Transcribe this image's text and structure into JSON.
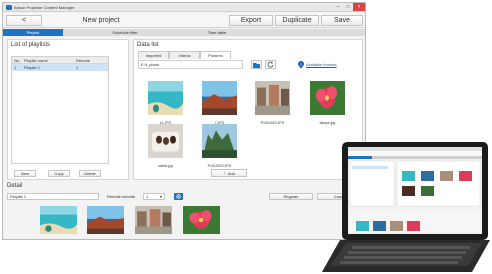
{
  "app_title": "Epson Projector Content Manager",
  "toolbar": {
    "back": "<",
    "project_name": "New project",
    "export": "Export",
    "duplicate": "Duplicate",
    "save": "Save"
  },
  "tabs": [
    "Playlist",
    "Schedule filter",
    "Time table"
  ],
  "playlists": {
    "heading": "List of playlists",
    "columns": [
      "No.",
      "Playlist name",
      "Remote"
    ],
    "rows": [
      {
        "no": "1",
        "name": "Playlist 1",
        "remote": "1"
      }
    ],
    "buttons": {
      "new": "New",
      "copy": "Copy",
      "delete": "Delete"
    }
  },
  "data_list": {
    "heading": "Data list",
    "tabs": [
      "Imported",
      "Videos",
      "Pictures"
    ],
    "path": "E:\\t_photo",
    "available_formats": "Available formats",
    "thumbnails": [
      {
        "caption": "11.JPG"
      },
      {
        "caption": "7.JPG"
      },
      {
        "caption": "P1010010.JPG"
      },
      {
        "caption": "lakeye.jpg"
      },
      {
        "caption": "sweet.jpg"
      },
      {
        "caption": "P1010013.JPG"
      }
    ],
    "add": "Add"
  },
  "detail": {
    "heading": "Detail",
    "playlist_name": "Playlist 1",
    "remote_label": "Remote favorite",
    "remote_value": "1",
    "register": "Register",
    "cancel": "Cancel"
  },
  "colors": {
    "accent": "#1f73c4",
    "selection": "#cde4f7",
    "close": "#e04343"
  }
}
